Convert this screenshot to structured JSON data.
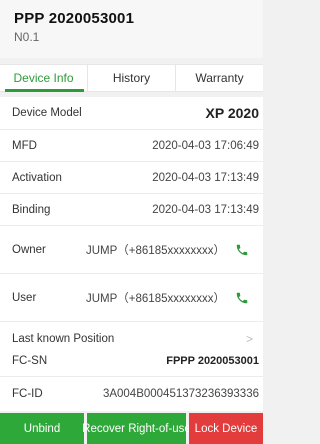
{
  "header": {
    "title": "PPP 2020053001",
    "subtitle": "N0.1"
  },
  "tabs": [
    {
      "label": "Device Info",
      "active": true
    },
    {
      "label": "History",
      "active": false
    },
    {
      "label": "Warranty",
      "active": false
    }
  ],
  "info": {
    "model": {
      "label": "Device Model",
      "value": "XP 2020"
    },
    "mfd": {
      "label": "MFD",
      "value": "2020-04-03 17:06:49"
    },
    "activation": {
      "label": "Activation",
      "value": "2020-04-03 17:13:49"
    },
    "binding": {
      "label": "Binding",
      "value": "2020-04-03 17:13:49"
    },
    "owner": {
      "label": "Owner",
      "value": "JUMP（+86185xxxxxxxx）"
    },
    "user": {
      "label": "User",
      "value": "JUMP（+86185xxxxxxxx）"
    },
    "position": {
      "label": "Last known Position",
      "chevron": ">"
    }
  },
  "ids": {
    "fc_sn": {
      "label": "FC-SN",
      "value": "FPPP 2020053001"
    },
    "fc_id": {
      "label": "FC-ID",
      "value": "3A004B000451373236393336"
    }
  },
  "buttons": {
    "unbind": "Unbind",
    "recover": "Recover Right-of-use",
    "lock": "Lock Device"
  },
  "colors": {
    "accent_green": "#2e9b3a",
    "button_green": "#2fa83a",
    "button_red": "#e23c3c"
  },
  "icons": {
    "phone": "phone-icon"
  }
}
